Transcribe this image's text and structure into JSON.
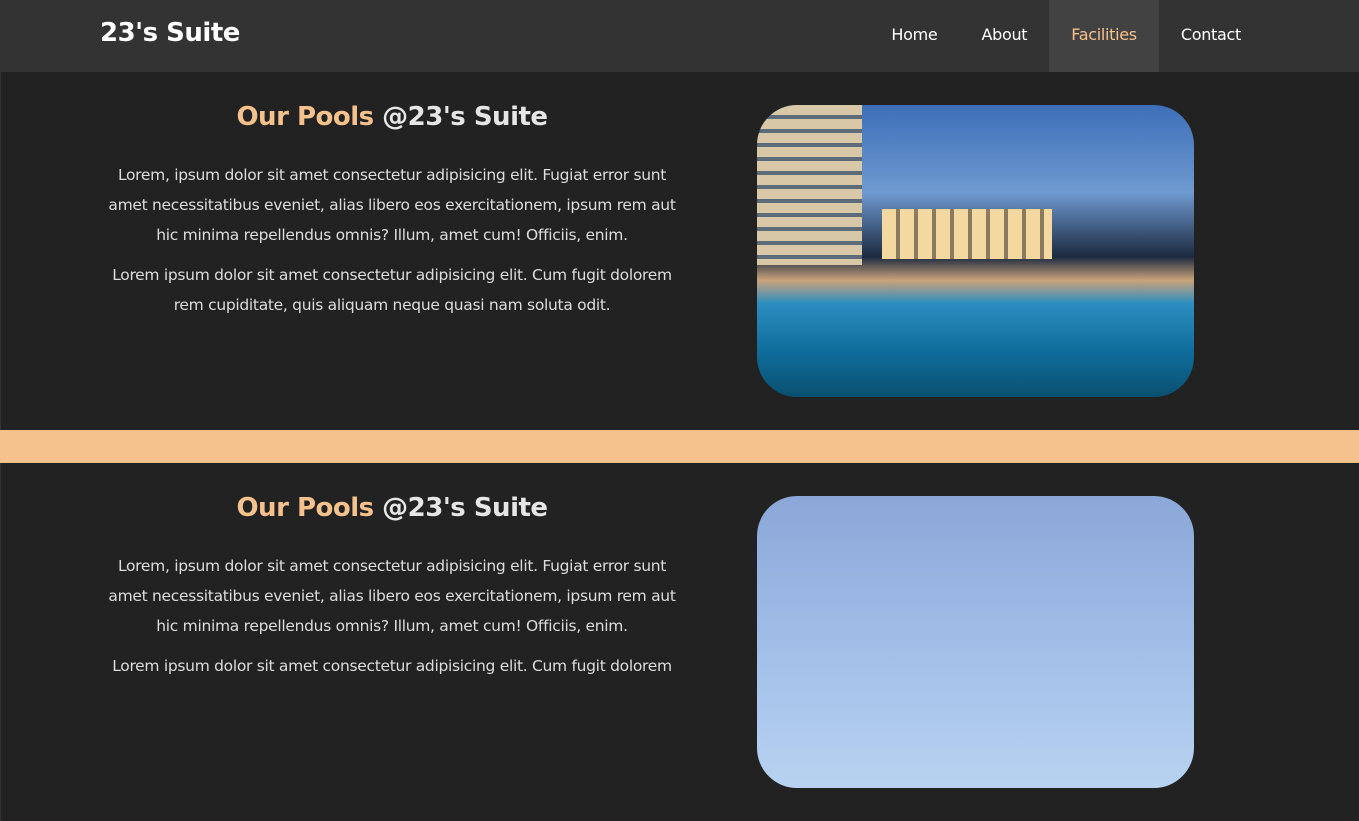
{
  "nav": {
    "logo": "23's Suite",
    "items": [
      {
        "label": "Home"
      },
      {
        "label": "About"
      },
      {
        "label": "Facilities",
        "active": true
      },
      {
        "label": "Contact"
      }
    ]
  },
  "colors": {
    "accent": "#f5c18c",
    "background": "#222222",
    "navbar": "#333333"
  },
  "sections": [
    {
      "title_highlight": "Our Pools",
      "title_rest": " @23's Suite",
      "p1": "Lorem, ipsum dolor sit amet consectetur adipisicing elit. Fugiat error sunt amet necessitatibus eveniet, alias libero eos exercitationem, ipsum rem aut hic minima repellendus omnis? Illum, amet cum! Officiis, enim.",
      "p2": "Lorem ipsum dolor sit amet consectetur adipisicing elit. Cum fugit dolorem rem cupiditate, quis aliquam neque quasi nam soluta odit."
    },
    {
      "title_highlight": "Our Pools",
      "title_rest": " @23's Suite",
      "p1": "Lorem, ipsum dolor sit amet consectetur adipisicing elit. Fugiat error sunt amet necessitatibus eveniet, alias libero eos exercitationem, ipsum rem aut hic minima repellendus omnis? Illum, amet cum! Officiis, enim.",
      "p2": "Lorem ipsum dolor sit amet consectetur adipisicing elit. Cum fugit dolorem"
    }
  ]
}
